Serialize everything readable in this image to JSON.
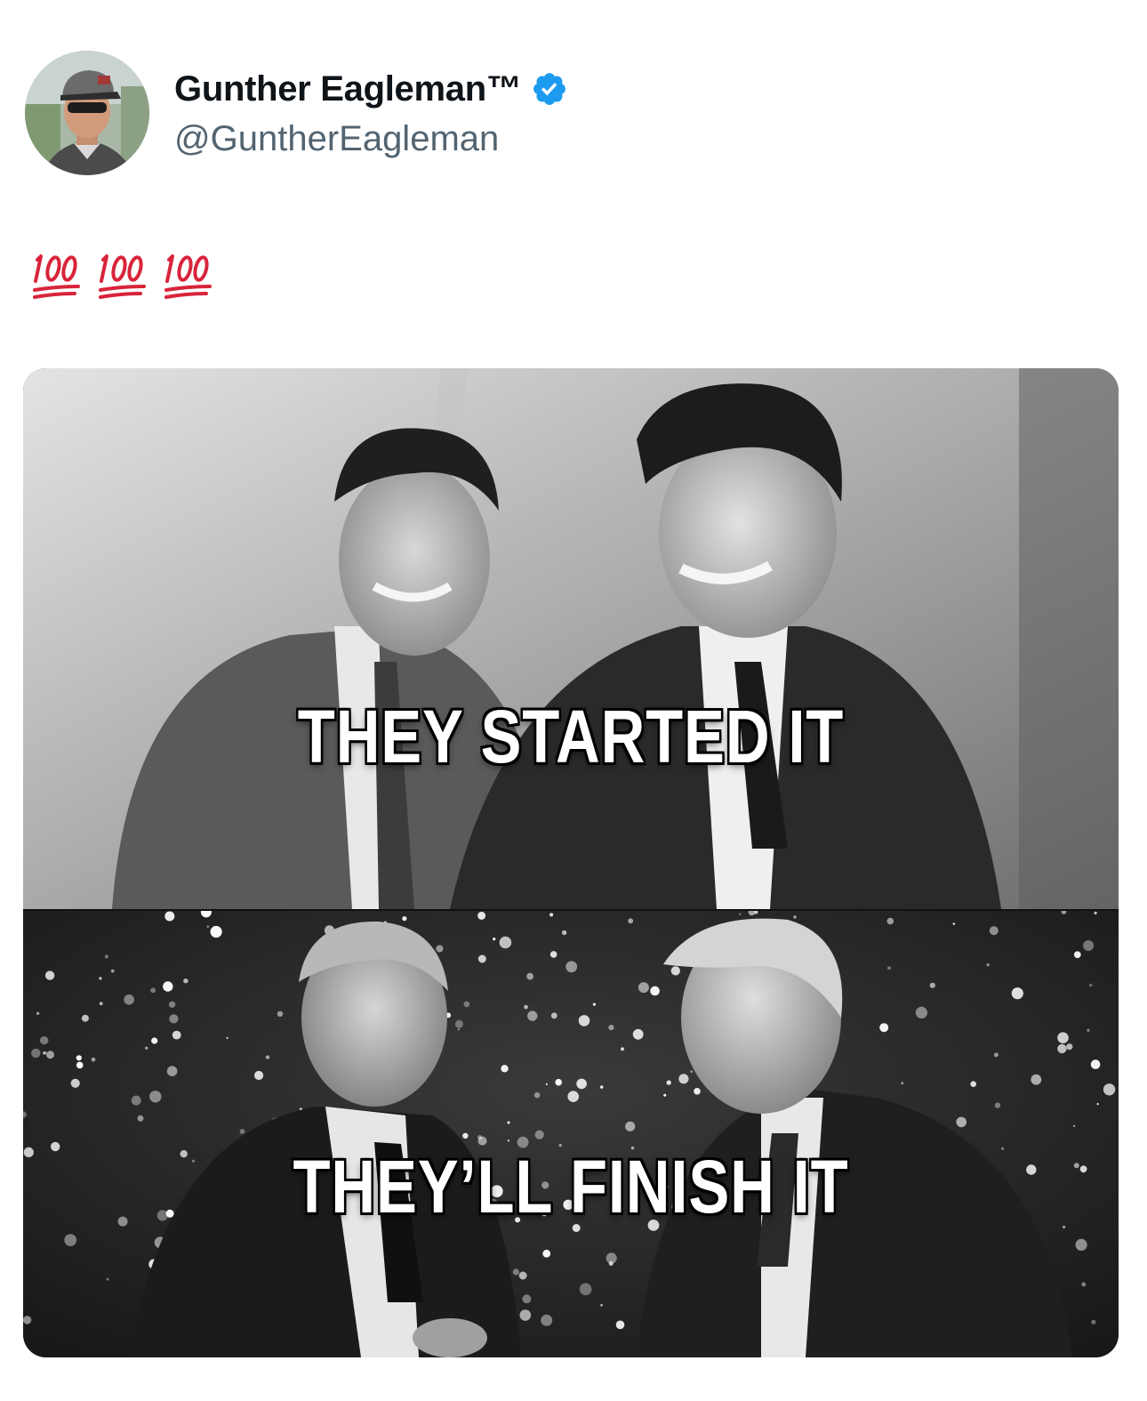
{
  "tweet": {
    "author": {
      "display_name": "Gunther Eagleman™",
      "handle": "@GuntherEagleman",
      "verified": true,
      "avatar_icon": "profile-photo"
    },
    "text_emoji": [
      "hundred-points-icon",
      "hundred-points-icon",
      "hundred-points-icon"
    ],
    "media": {
      "top_caption": "THEY STARTED IT",
      "bottom_caption": "THEY’LL FINISH IT"
    }
  },
  "colors": {
    "verified_blue": "#1d9bf0",
    "handle_gray": "#536471",
    "emoji_red": "#d8243a"
  }
}
